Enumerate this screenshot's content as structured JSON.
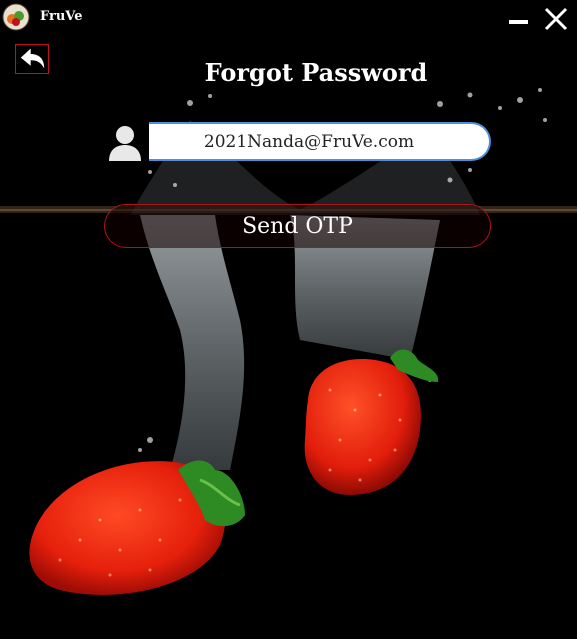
{
  "window": {
    "app_name": "FruVe"
  },
  "page": {
    "title": "Forgot Password"
  },
  "form": {
    "email_value": "2021Nanda@FruVe.com",
    "send_otp_label": "Send OTP"
  },
  "colors": {
    "background": "#000000",
    "accent_red": "#c0121e",
    "input_border_blue": "#4f8fd9",
    "strawberry_red": "#e8210f"
  },
  "icons": {
    "back": "back-arrow-icon",
    "user": "user-icon",
    "minimize": "minimize-icon",
    "close": "close-icon",
    "logo": "fruve-logo-icon"
  }
}
